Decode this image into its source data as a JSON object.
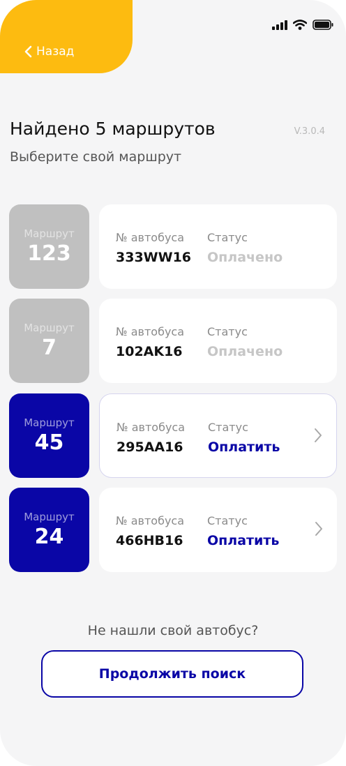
{
  "header": {
    "back_label": "Назад"
  },
  "title": "Найдено 5 маршрутов",
  "version": "V.3.0.4",
  "subtitle": "Выберите свой маршрут",
  "columns": {
    "bus": "№ автобуса",
    "status": "Статус"
  },
  "route_word": "Маршрут",
  "routes": [
    {
      "number": "123",
      "plate": "333WW16",
      "status": "Оплачено",
      "paid": true
    },
    {
      "number": "7",
      "plate": "102AK16",
      "status": "Оплачено",
      "paid": true
    },
    {
      "number": "45",
      "plate": "295AA16",
      "status": "Оплатить",
      "paid": false
    },
    {
      "number": "24",
      "plate": "466HB16",
      "status": "Оплатить",
      "paid": false
    }
  ],
  "footer": {
    "question": "Не нашли свой автобус?",
    "continue_label": "Продолжить поиск"
  },
  "colors": {
    "accent_yellow": "#fdbb10",
    "accent_blue": "#0a06a6",
    "paid_gray": "#c0c0c0"
  }
}
